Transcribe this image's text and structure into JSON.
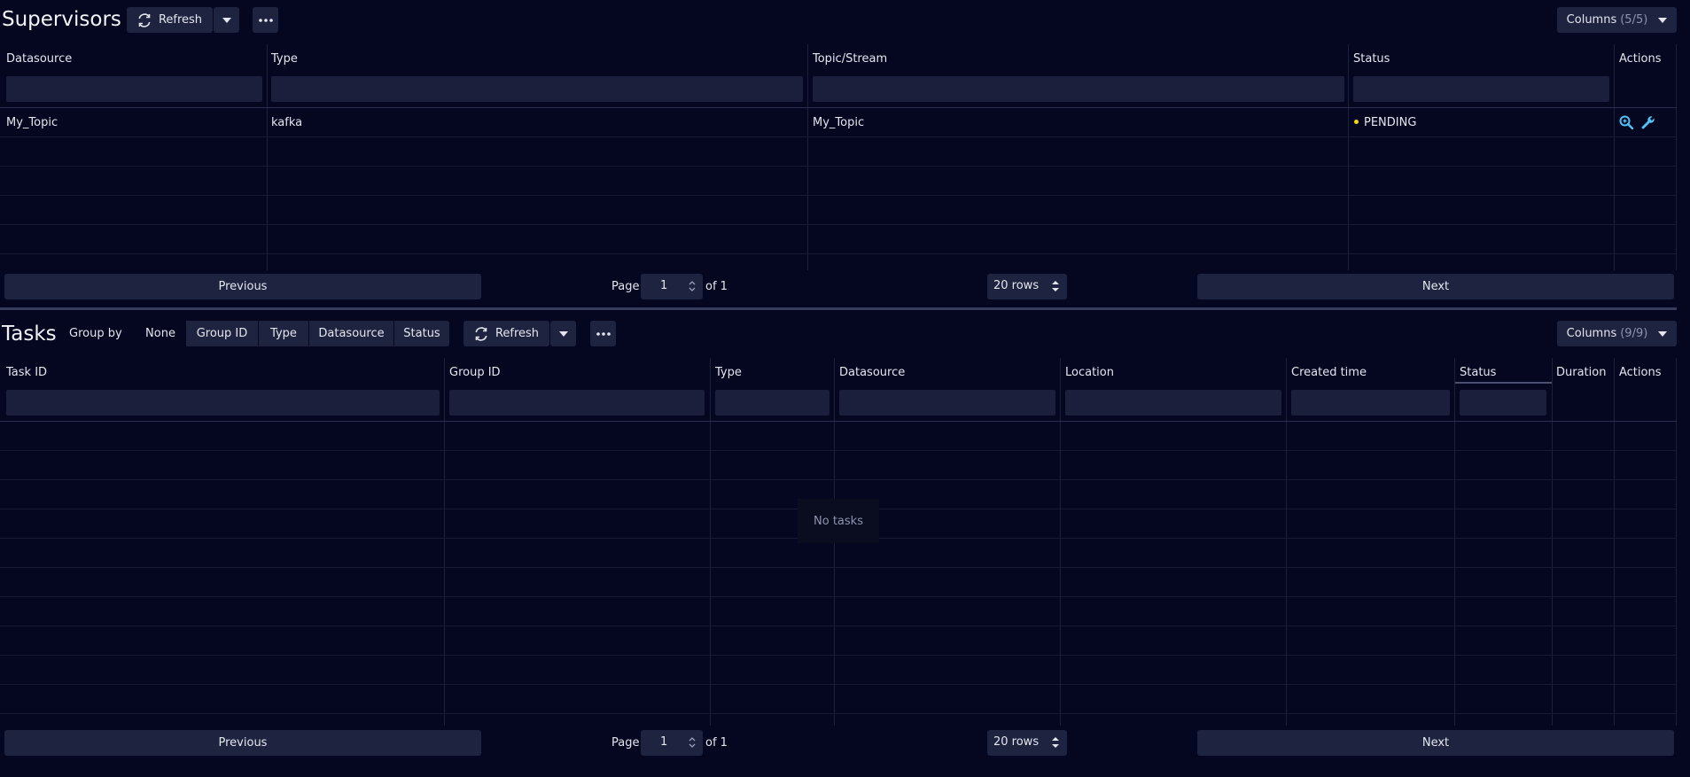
{
  "supervisors": {
    "title": "Supervisors",
    "refresh_label": "Refresh",
    "columns_label": "Columns",
    "columns_count": "(5/5)",
    "headers": [
      "Datasource",
      "Type",
      "Topic/Stream",
      "Status",
      "Actions"
    ],
    "rows": [
      {
        "datasource": "My_Topic",
        "type": "kafka",
        "topic": "My_Topic",
        "status": "PENDING"
      }
    ],
    "pagination": {
      "previous": "Previous",
      "page_label": "Page",
      "page_value": "1",
      "of_label": "of 1",
      "rows_value": "20 rows",
      "next": "Next"
    }
  },
  "tasks": {
    "title": "Tasks",
    "group_by_label": "Group by",
    "group_options": [
      "None",
      "Group ID",
      "Type",
      "Datasource",
      "Status"
    ],
    "refresh_label": "Refresh",
    "columns_label": "Columns",
    "columns_count": "(9/9)",
    "headers": [
      "Task ID",
      "Group ID",
      "Type",
      "Datasource",
      "Location",
      "Created time",
      "Status",
      "Duration",
      "Actions"
    ],
    "empty_text": "No tasks",
    "pagination": {
      "previous": "Previous",
      "page_label": "Page",
      "page_value": "1",
      "of_label": "of 1",
      "rows_value": "20 rows",
      "next": "Next"
    }
  },
  "colors": {
    "background": "#050620",
    "pending": "#f5d90a",
    "action_icon": "#4fc3f7"
  }
}
